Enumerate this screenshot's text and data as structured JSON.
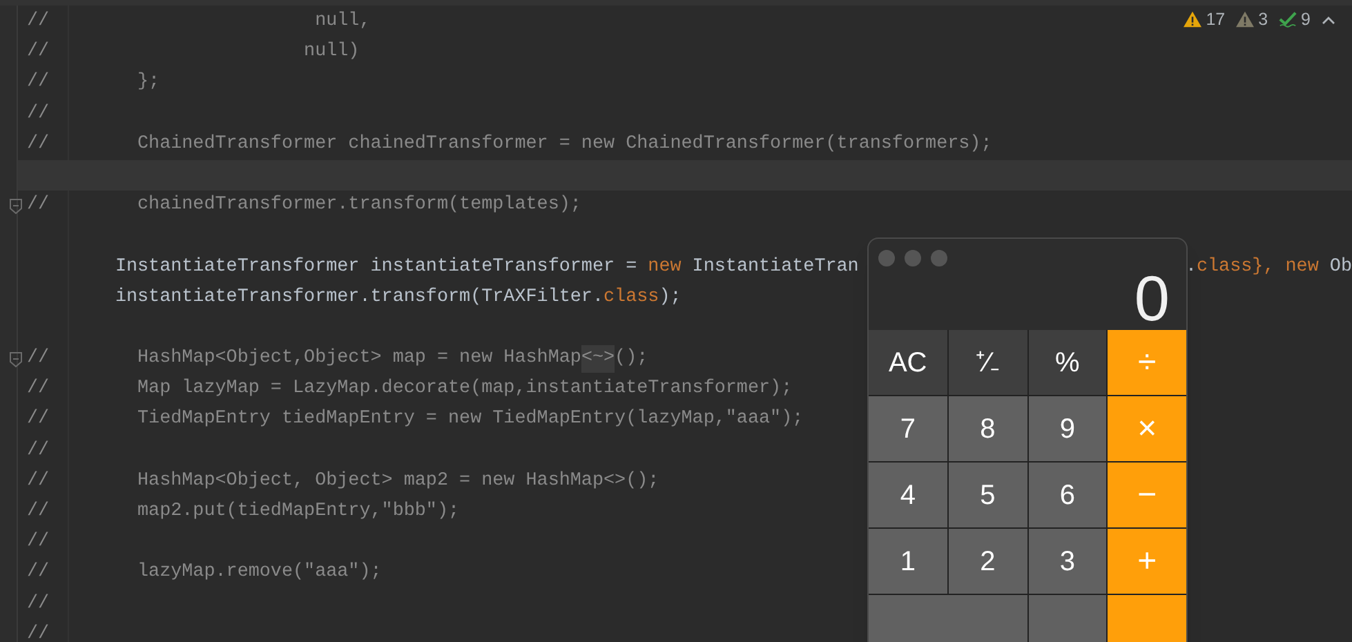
{
  "inspections": [
    {
      "kind": "warning",
      "count": "17"
    },
    {
      "kind": "weak",
      "count": "3"
    },
    {
      "kind": "typo",
      "count": "9"
    }
  ],
  "editor": {
    "lines": [
      {
        "marker": "//",
        "fold": false,
        "segments": [
          {
            "kind": "comment",
            "text": "                  null,"
          }
        ]
      },
      {
        "marker": "//",
        "fold": false,
        "segments": [
          {
            "kind": "comment",
            "text": "                 null)"
          }
        ]
      },
      {
        "marker": "//",
        "fold": false,
        "segments": [
          {
            "kind": "comment",
            "text": "  };"
          }
        ]
      },
      {
        "marker": "//",
        "fold": false
      },
      {
        "marker": "//",
        "fold": false,
        "segments": [
          {
            "kind": "comment",
            "text": "  ChainedTransformer chainedTransformer = new ChainedTransformer(transformers);"
          }
        ]
      },
      {
        "fold": false,
        "current": true
      },
      {
        "marker": "//",
        "fold": true,
        "segments": [
          {
            "kind": "comment",
            "text": "  chainedTransformer.transform(templates);"
          }
        ]
      },
      {
        "fold": false
      },
      {
        "fold": false,
        "segments": [
          {
            "kind": "plain",
            "text": "InstantiateTransformer instantiateTransformer = "
          },
          {
            "kind": "keyword",
            "text": "new"
          },
          {
            "kind": "plain",
            "text": " InstantiateTran"
          }
        ],
        "tail": [
          {
            "kind": "plain",
            "text": "."
          },
          {
            "kind": "keyword",
            "text": "class}, new"
          },
          {
            "kind": "plain",
            "text": " Ob"
          }
        ]
      },
      {
        "fold": false,
        "segments": [
          {
            "kind": "plain",
            "text": "instantiateTransformer.transform(TrAXFilter."
          },
          {
            "kind": "keyword",
            "text": "class"
          },
          {
            "kind": "plain",
            "text": ");"
          }
        ]
      },
      {
        "fold": false
      },
      {
        "marker": "//",
        "fold": true,
        "segments": [
          {
            "kind": "comment",
            "text": "  HashMap<Object,Object> map = new HashMap"
          },
          {
            "kind": "folded",
            "text": "<~>"
          },
          {
            "kind": "comment",
            "text": "();"
          }
        ]
      },
      {
        "marker": "//",
        "fold": false,
        "segments": [
          {
            "kind": "comment",
            "text": "  Map lazyMap = LazyMap.decorate(map,instantiateTransformer);"
          }
        ]
      },
      {
        "marker": "//",
        "fold": false,
        "segments": [
          {
            "kind": "comment",
            "text": "  TiedMapEntry tiedMapEntry = new TiedMapEntry(lazyMap,\"aaa\");"
          }
        ]
      },
      {
        "marker": "//",
        "fold": false
      },
      {
        "marker": "//",
        "fold": false,
        "segments": [
          {
            "kind": "comment",
            "text": "  HashMap<Object, Object> map2 = new HashMap<>();"
          }
        ]
      },
      {
        "marker": "//",
        "fold": false,
        "segments": [
          {
            "kind": "comment",
            "text": "  map2.put(tiedMapEntry,\"bbb\");"
          }
        ]
      },
      {
        "marker": "//",
        "fold": false
      },
      {
        "marker": "//",
        "fold": false,
        "segments": [
          {
            "kind": "comment",
            "text": "  lazyMap.remove(\"aaa\");"
          }
        ]
      },
      {
        "marker": "//",
        "fold": false
      },
      {
        "marker": "//",
        "fold": false
      }
    ]
  },
  "calculator": {
    "display": "0",
    "buttons": [
      {
        "kind": "function",
        "label": "AC"
      },
      {
        "kind": "function",
        "label": "⁺∕₋"
      },
      {
        "kind": "function",
        "label": "%"
      },
      {
        "kind": "operator",
        "label": "÷"
      },
      {
        "kind": "digit",
        "label": "7"
      },
      {
        "kind": "digit",
        "label": "8"
      },
      {
        "kind": "digit",
        "label": "9"
      },
      {
        "kind": "operator",
        "label": "×"
      },
      {
        "kind": "digit",
        "label": "4"
      },
      {
        "kind": "digit",
        "label": "5"
      },
      {
        "kind": "digit",
        "label": "6"
      },
      {
        "kind": "operator",
        "label": "−"
      },
      {
        "kind": "digit",
        "label": "1"
      },
      {
        "kind": "digit",
        "label": "2"
      },
      {
        "kind": "digit",
        "label": "3"
      },
      {
        "kind": "operator",
        "label": "+"
      },
      {
        "kind": "wide"
      },
      {
        "kind": "digit"
      },
      {
        "kind": "operator"
      }
    ]
  }
}
